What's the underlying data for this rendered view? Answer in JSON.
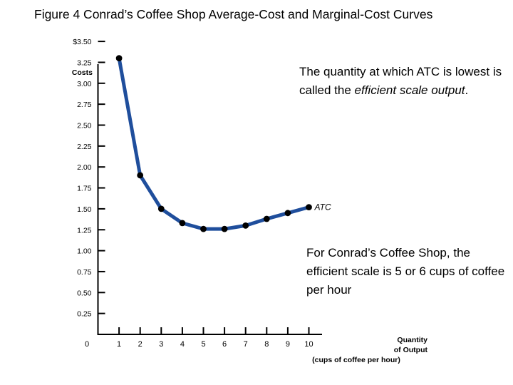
{
  "slide": {
    "title": "Figure 4 Conrad’s Coffee Shop Average-Cost and Marginal-Cost Curves"
  },
  "callouts": {
    "top": {
      "line1": "The quantity at which ATC",
      "line2": "is lowest is called the",
      "line3_italic": "efficient scale output",
      "line3_tail": "."
    },
    "bottom": {
      "line1": "For Conrad’s Coffee Shop,",
      "line2": "the efficient scale is 5 or 6",
      "line3": "cups of coffee per hour"
    }
  },
  "chart_data": {
    "type": "line",
    "title": "",
    "xlabel": "Quantity of Output (cups of coffee per hour)",
    "ylabel": "Costs",
    "y_axis_header": "Costs",
    "x_axis_title_line1": "Quantity",
    "x_axis_title_line2": "of Output",
    "x_axis_title_line3": "(cups of coffee per hour)",
    "origin_label": "0",
    "grid": false,
    "legend_position": "inline-end-of-curve",
    "xlim": [
      0,
      10
    ],
    "ylim": [
      0,
      3.5
    ],
    "x_ticks": [
      0,
      1,
      2,
      3,
      4,
      5,
      6,
      7,
      8,
      9,
      10
    ],
    "x_tick_labels": [
      "0",
      "1",
      "2",
      "3",
      "4",
      "5",
      "6",
      "7",
      "8",
      "9",
      "10"
    ],
    "y_ticks": [
      0.25,
      0.5,
      0.75,
      1.0,
      1.25,
      1.5,
      1.75,
      2.0,
      2.25,
      2.5,
      2.75,
      3.0,
      3.25,
      3.5
    ],
    "y_tick_labels": [
      "0.25",
      "0.50",
      "0.75",
      "1.00",
      "1.25",
      "1.50",
      "1.75",
      "2.00",
      "2.25",
      "2.50",
      "2.75",
      "3.00",
      "3.25",
      "$3.50"
    ],
    "series": [
      {
        "name": "ATC",
        "label": "ATC",
        "color": "#1F4E9C",
        "marker_color": "#000000",
        "x": [
          1,
          2,
          3,
          4,
          5,
          6,
          7,
          8,
          9,
          10
        ],
        "values": [
          3.3,
          1.9,
          1.5,
          1.33,
          1.26,
          1.26,
          1.3,
          1.38,
          1.45,
          1.52
        ]
      }
    ]
  }
}
